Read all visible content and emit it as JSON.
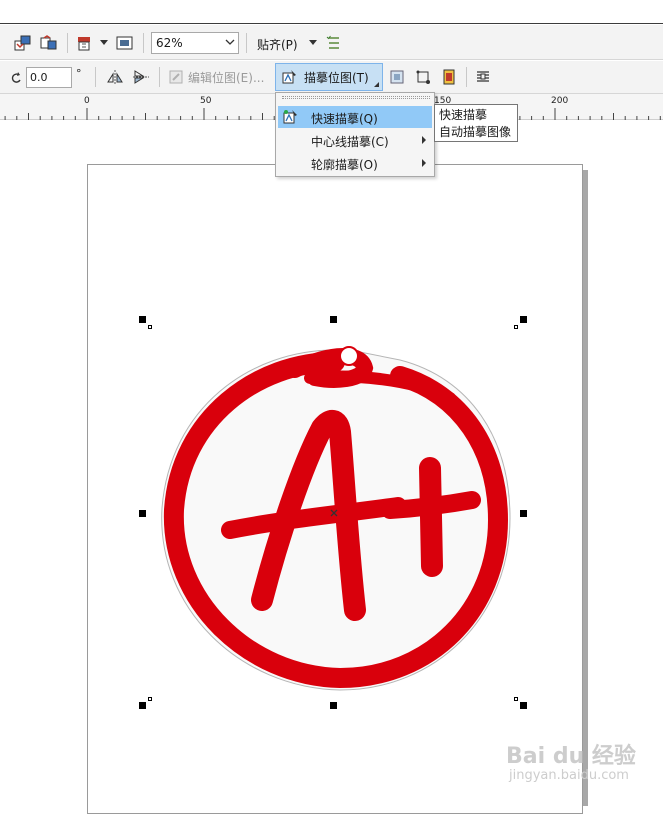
{
  "toolbar_main": {
    "zoom_value": "62%",
    "snap_label": "贴齐(P)"
  },
  "property_bar": {
    "rotation_value": "0.0",
    "degree_symbol": "°",
    "edit_bitmap_label": "编辑位图(E)...",
    "trace_bitmap_label": "描摹位图(T)"
  },
  "ruler": {
    "labels": [
      "0",
      "50",
      "150",
      "200"
    ]
  },
  "trace_menu": {
    "items": [
      {
        "label": "快速描摹(Q)",
        "highlighted": true,
        "has_submenu": false
      },
      {
        "label": "中心线描摹(C)",
        "highlighted": false,
        "has_submenu": true
      },
      {
        "label": "轮廓描摹(O)",
        "highlighted": false,
        "has_submenu": true
      }
    ]
  },
  "tooltip": {
    "title": "快速描摹",
    "description": "自动描摹图像"
  },
  "artwork": {
    "text": "A+",
    "stroke_color": "#d9000c"
  },
  "watermark": {
    "logo_text": "Bai du 经验",
    "url_text": "jingyan.baidu.com"
  },
  "colors": {
    "toolbar_bg": "#f3f3f3",
    "menu_highlight": "#91c9f7",
    "accent_red": "#d9000c"
  }
}
